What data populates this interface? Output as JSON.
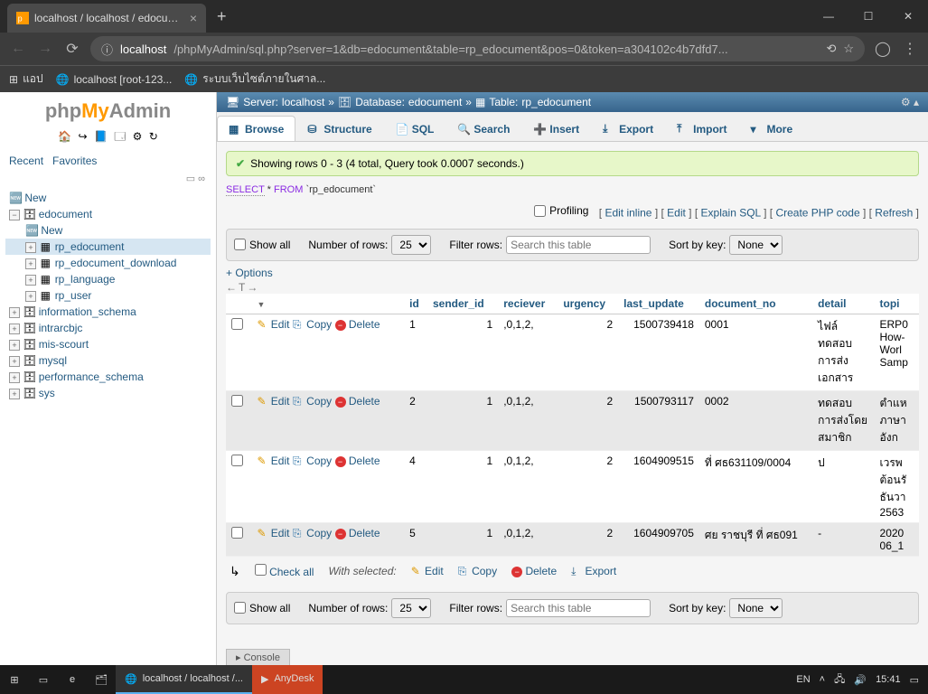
{
  "browser": {
    "tab_title": "localhost / localhost / edocumen",
    "newtab_plus": "+",
    "url_host": "localhost",
    "url_path": "/phpMyAdmin/sql.php?server=1&db=edocument&table=rp_edocument&pos=0&token=a304102c4b7dfd7...",
    "bookmarks_label": "แอป",
    "bm1": "localhost [root-123...",
    "bm2": "ระบบเว็บไซต์ภายในศาล..."
  },
  "logo": {
    "p1": "php",
    "p2": "My",
    "p3": "Admin"
  },
  "sidetabs": {
    "recent": "Recent",
    "fav": "Favorites"
  },
  "tree": {
    "new": "New",
    "db": "edocument",
    "db_new": "New",
    "t1": "rp_edocument",
    "t2": "rp_edocument_download",
    "t3": "rp_language",
    "t4": "rp_user",
    "d2": "information_schema",
    "d3": "intrarcbjc",
    "d4": "mis-scourt",
    "d5": "mysql",
    "d6": "performance_schema",
    "d7": "sys"
  },
  "breadcrumb": {
    "server_lbl": "Server:",
    "server": "localhost",
    "db_lbl": "Database:",
    "db": "edocument",
    "tbl_lbl": "Table:",
    "tbl": "rp_edocument",
    "sep": "»"
  },
  "maintabs": {
    "browse": "Browse",
    "structure": "Structure",
    "sql": "SQL",
    "search": "Search",
    "insert": "Insert",
    "export": "Export",
    "import": "Import",
    "more": "More"
  },
  "success_msg": "Showing rows 0 - 3 (4 total, Query took 0.0007 seconds.)",
  "sql": {
    "select": "SELECT",
    "star": " * ",
    "from": "FROM",
    "tbl": " `rp_edocument`"
  },
  "actions": {
    "profiling": "Profiling",
    "edit_inline": "Edit inline",
    "edit": "Edit",
    "explain": "Explain SQL",
    "createphp": "Create PHP code",
    "refresh": "Refresh"
  },
  "filters": {
    "showall": "Show all",
    "numrows": "Number of rows:",
    "numrows_val": "25",
    "filterrows": "Filter rows:",
    "filter_ph": "Search this table",
    "sortkey": "Sort by key:",
    "sortkey_val": "None"
  },
  "options": "+ Options",
  "navsym": "←T→",
  "headers": {
    "id": "id",
    "sender_id": "sender_id",
    "reciever": "reciever",
    "urgency": "urgency",
    "last_update": "last_update",
    "document_no": "document_no",
    "detail": "detail",
    "topic": "topi"
  },
  "rowactions": {
    "edit": "Edit",
    "copy": "Copy",
    "delete": "Delete"
  },
  "rows": [
    {
      "id": "1",
      "sender_id": "1",
      "reciever": ",0,1,2,",
      "urgency": "2",
      "last_update": "1500739418",
      "document_no": "0001",
      "detail": "ไฟล์ทดสอบการส่งเอกสาร",
      "topic": "ERP0\nHow-\nWorl\nSamp"
    },
    {
      "id": "2",
      "sender_id": "1",
      "reciever": ",0,1,2,",
      "urgency": "2",
      "last_update": "1500793117",
      "document_no": "0002",
      "detail": "ทดสอบการส่งโดยสมาชิก",
      "topic": "ตำแห\nภาษา\nอังก"
    },
    {
      "id": "4",
      "sender_id": "1",
      "reciever": ",0,1,2,",
      "urgency": "2",
      "last_update": "1604909515",
      "document_no": "ที่ ศธ631109/0004",
      "detail": "ป",
      "topic": "เวรพ\nต้อนรั\nธันวา\n2563"
    },
    {
      "id": "5",
      "sender_id": "1",
      "reciever": ",0,1,2,",
      "urgency": "2",
      "last_update": "1604909705",
      "document_no": "ศย ราชบุรี ที่ ศธ091",
      "detail": "-",
      "topic": "2020\n06_1"
    }
  ],
  "bulk": {
    "checkall": "Check all",
    "withsel": "With selected:",
    "edit": "Edit",
    "copy": "Copy",
    "delete": "Delete",
    "export": "Export"
  },
  "console": "Console",
  "taskbar": {
    "chrome": "localhost / localhost /...",
    "anydesk": "AnyDesk",
    "lang": "EN",
    "time": "15:41"
  }
}
